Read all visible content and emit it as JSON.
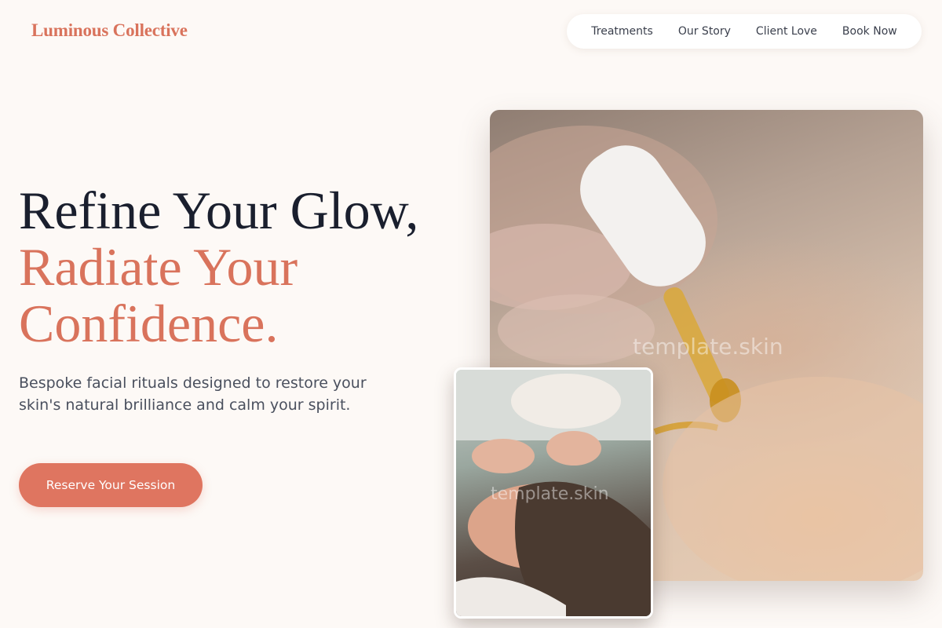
{
  "brand": {
    "logo_text": "Luminous Collective",
    "accent_color": "#d9735c"
  },
  "nav": {
    "items": [
      {
        "label": "Treatments"
      },
      {
        "label": "Our Story"
      },
      {
        "label": "Client Love"
      },
      {
        "label": "Book Now"
      }
    ]
  },
  "hero": {
    "headline_line1": "Refine Your Glow,",
    "headline_line2": "Radiate Your",
    "headline_line3": "Confidence.",
    "subtext": "Bespoke facial rituals designed to restore your skin's natural brilliance and calm your spirit.",
    "cta_label": "Reserve Your Session",
    "cta_color": "#df7560"
  },
  "images": {
    "main_watermark": "template.skin",
    "inset_watermark": "template.skin"
  }
}
